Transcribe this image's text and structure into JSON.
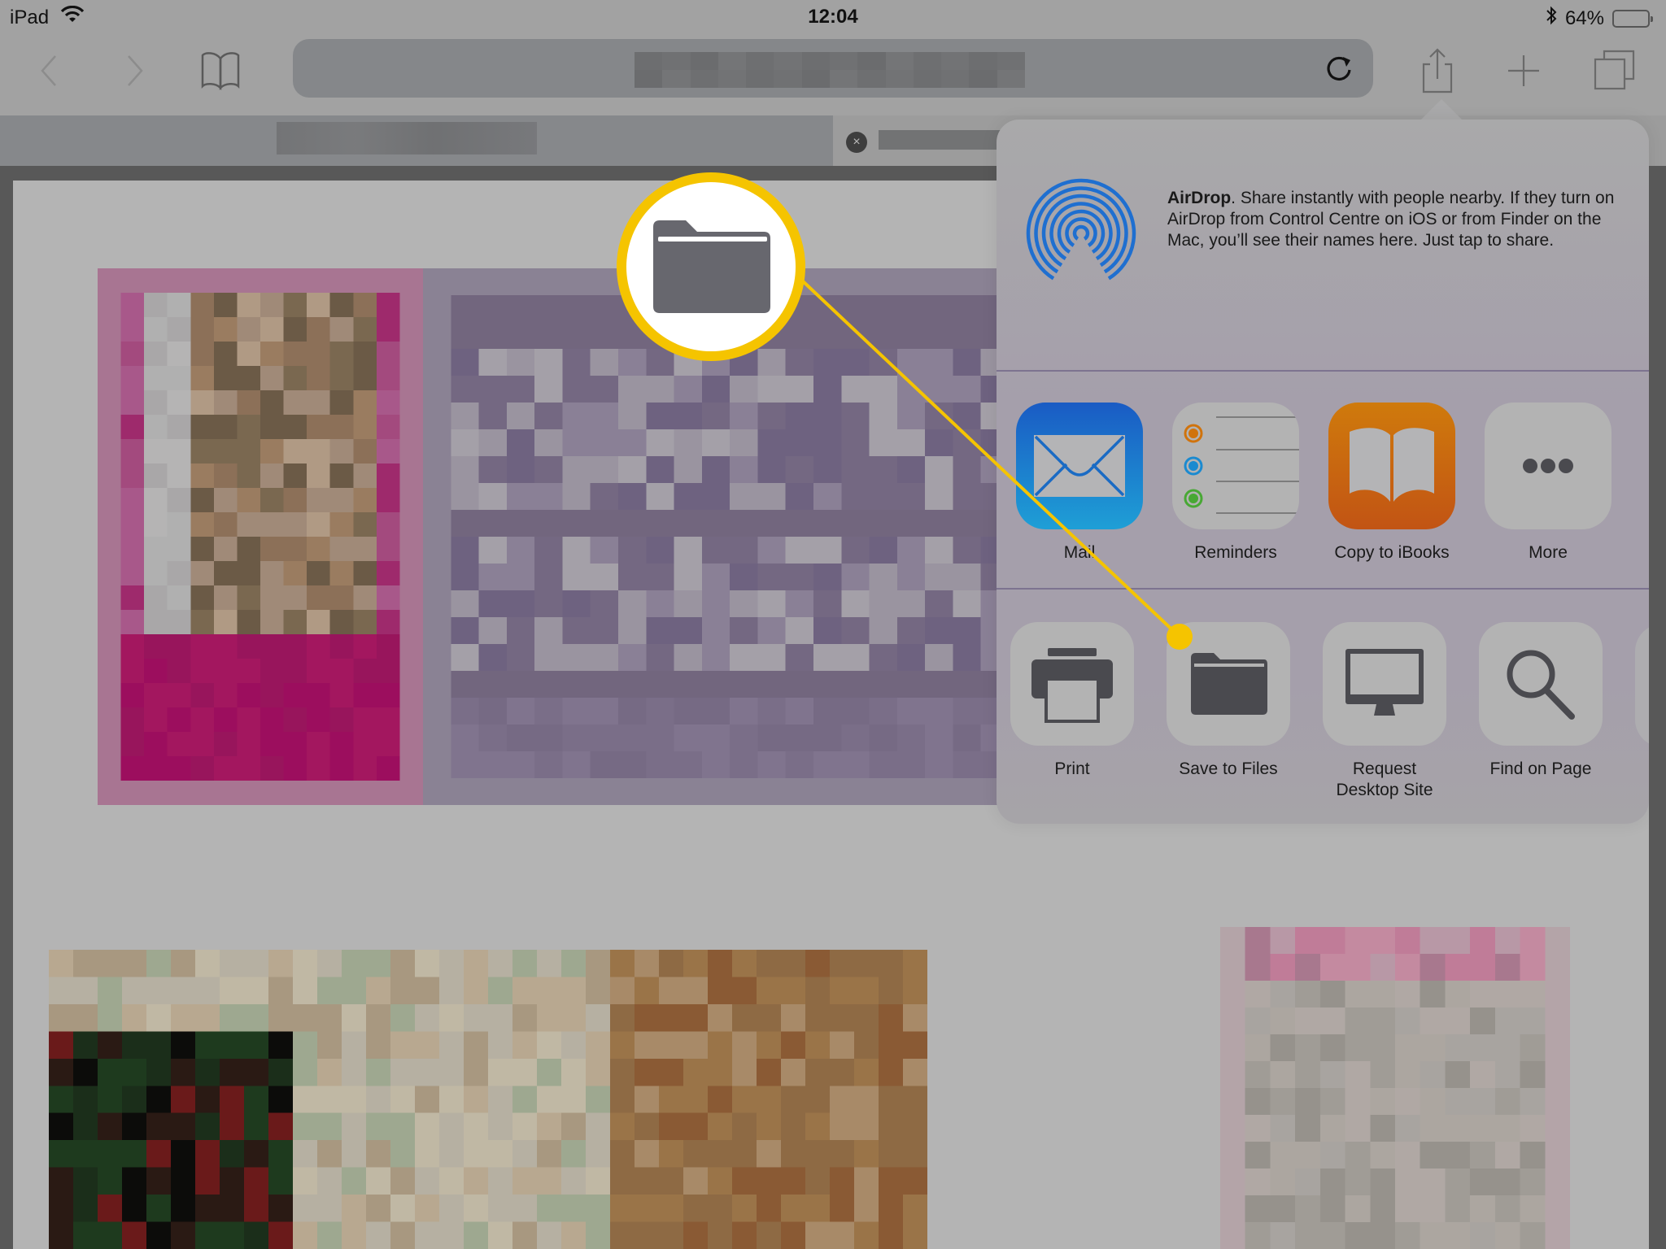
{
  "status_bar": {
    "device": "iPad",
    "time": "12:04",
    "battery_percent": "64%",
    "battery_level": 0.64
  },
  "toolbar": {
    "back_icon": "chevron-left-icon",
    "forward_icon": "chevron-right-icon",
    "bookmarks_icon": "book-icon",
    "reload_icon": "reload-icon",
    "share_icon": "share-icon",
    "new_tab_icon": "plus-icon",
    "tabs_icon": "tabs-icon",
    "url_blurred": true
  },
  "tabs": [
    {
      "title_blurred": true,
      "active": true
    },
    {
      "title_blurred": true,
      "active": false,
      "close_label": "×"
    }
  ],
  "share_sheet": {
    "airdrop": {
      "title": "AirDrop",
      "description": ". Share instantly with people nearby. If they turn on AirDrop from Control Centre on iOS or from Finder on the Mac, you’ll see their names here. Just tap to share."
    },
    "apps": [
      {
        "label": "Mail",
        "icon": "mail-icon"
      },
      {
        "label": "Reminders",
        "icon": "reminders-icon"
      },
      {
        "label": "Copy to iBooks",
        "icon": "ibooks-icon"
      },
      {
        "label": "More",
        "icon": "more-icon"
      }
    ],
    "actions": [
      {
        "label": "Print",
        "icon": "printer-icon"
      },
      {
        "label": "Save to Files",
        "icon": "folder-icon"
      },
      {
        "label": "Request Desktop Site",
        "icon": "desktop-icon"
      },
      {
        "label": "Find on Page",
        "icon": "search-icon"
      }
    ]
  },
  "callout": {
    "icon": "folder-icon",
    "target": "Save to Files",
    "color": "#f5c400"
  },
  "colors": {
    "accent_yellow": "#f5c400",
    "airdrop_blue": "#1f6fd0",
    "mail_blue_top": "#1a5bc4",
    "mail_blue_bottom": "#1e9fd6",
    "ibooks_orange_top": "#cf7a0c",
    "ibooks_orange_bottom": "#c25414",
    "icon_gray": "#4a4a4f"
  }
}
